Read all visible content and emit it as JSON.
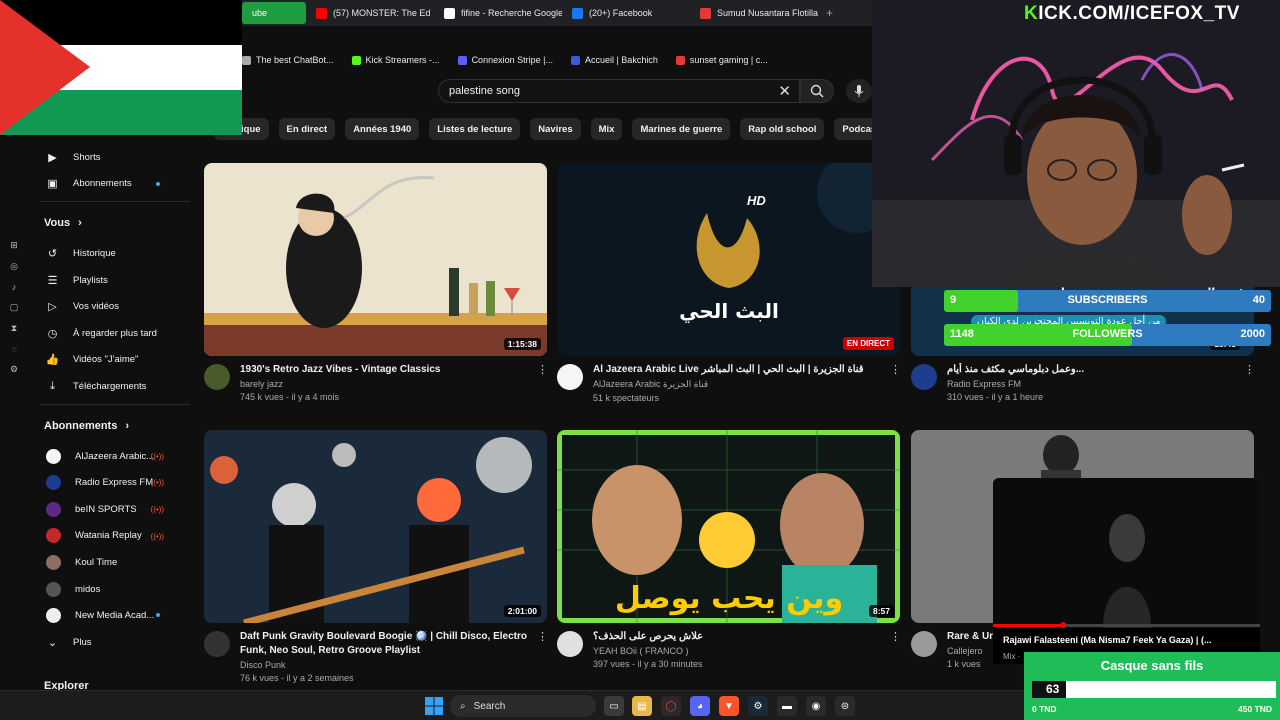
{
  "browser": {
    "tabs": [
      {
        "label": "ube",
        "active": true,
        "icon_color": "#1e9e3e"
      },
      {
        "label": "(57) MONSTER: The Ed",
        "icon_color": "#ff0000"
      },
      {
        "label": "fifine - Recherche Google",
        "icon_color": "#ffffff"
      },
      {
        "label": "(20+) Facebook",
        "icon_color": "#1877f2"
      },
      {
        "label": "Sumud Nusantara Flotilla",
        "icon_color": "#e53935"
      }
    ],
    "bookmarks": [
      {
        "label": "The best ChatBot...",
        "icon_color": "#aaaaaa"
      },
      {
        "label": "Kick Streamers -...",
        "icon_color": "#53fc18"
      },
      {
        "label": "Connexion Stripe |...",
        "icon_color": "#635bff"
      },
      {
        "label": "Accueil | Bakchich",
        "icon_color": "#3b5bdb"
      },
      {
        "label": "sunset gaming | c...",
        "icon_color": "#e53935"
      }
    ]
  },
  "youtube": {
    "search": {
      "value": "palestine song"
    },
    "chips": [
      "Musique",
      "En direct",
      "Années 1940",
      "Listes de lecture",
      "Navires",
      "Mix",
      "Marines de guerre",
      "Rap old school",
      "Podcasts"
    ],
    "sidebar": {
      "top_items": [
        {
          "label": "Shorts",
          "icon": "shorts-icon",
          "glyph": "▶"
        },
        {
          "label": "Abonnements",
          "icon": "subscriptions-icon",
          "glyph": "▣",
          "dot": true
        }
      ],
      "you_heading": "Vous",
      "you_items": [
        {
          "label": "Historique",
          "icon": "history-icon",
          "glyph": "↺"
        },
        {
          "label": "Playlists",
          "icon": "playlists-icon",
          "glyph": "☰"
        },
        {
          "label": "Vos vidéos",
          "icon": "your-videos-icon",
          "glyph": "▷"
        },
        {
          "label": "À regarder plus tard",
          "icon": "watch-later-icon",
          "glyph": "◷"
        },
        {
          "label": "Vidéos \"J'aime\"",
          "icon": "liked-icon",
          "glyph": "👍"
        },
        {
          "label": "Téléchargements",
          "icon": "downloads-icon",
          "glyph": "⤓"
        }
      ],
      "subs_heading": "Abonnements",
      "subs": [
        {
          "label": "AlJazeera Arabic...",
          "color": "#f5f5f5",
          "live": true
        },
        {
          "label": "Radio Express FM",
          "color": "#1d3d8f",
          "live": true
        },
        {
          "label": "beIN SPORTS",
          "color": "#5b2a86",
          "live": true
        },
        {
          "label": "Watania Replay",
          "color": "#c62828",
          "live": true
        },
        {
          "label": "Koul Time",
          "color": "#8d6e63",
          "live": false
        },
        {
          "label": "midos",
          "color": "#555555",
          "live": false
        },
        {
          "label": "New Media Acad...",
          "color": "#eeeeee",
          "dot": true
        }
      ],
      "more_label": "Plus",
      "explorer_label": "Explorer"
    },
    "videos": [
      {
        "title": "1930's Retro Jazz Vibes - Vintage Classics",
        "channel": "barely jazz",
        "stats": "745 k vues - il y a 4 mois",
        "duration": "1:15:38",
        "avatar_color": "#4a5a2a"
      },
      {
        "title": "Al Jazeera Arabic Live قناة الجزيرة | البث الحي | البث المباشر",
        "channel": "AlJazeera Arabic قناة الجزيرة",
        "stats": "51 k spectateurs",
        "badge": "EN DIRECT",
        "avatar_color": "#f5f5f5"
      },
      {
        "title": "وعمل دبلوماسي مكثف منذ أيام...",
        "channel": "Radio Express FM",
        "stats": "310 vues - il y a 1 heure",
        "avatar_color": "#1d3d8f",
        "thumb_time": "18:45"
      },
      {
        "title": "Daft Punk Gravity Boulevard Boogie 🪩 | Chill Disco, Electro Funk, Neo Soul, Retro Groove Playlist",
        "channel": "Disco Punk",
        "stats": "76 k vues - il y a 2 semaines",
        "duration": "2:01:00",
        "avatar_color": "#333333"
      },
      {
        "title": "علاش يحرص على الحذف؟",
        "channel": "YEAH BOii ( FRANCO )",
        "stats": "397 vues - il y a 30 minutes",
        "duration": "8:57",
        "avatar_color": "#e0e0e0"
      },
      {
        "title": "Rare & Unr",
        "channel": "Callejero",
        "stats": "1 k vues",
        "avatar_color": "#999999"
      }
    ],
    "thumb_texts": {
      "aj_hd": "HD",
      "aj_live": "البث الحي",
      "yeah": "وين يحب يوصل",
      "radio_line1": "رئيس الجمهورية يدعو بضرورة مضا",
      "radio_line2": "من أجل عودة التونسيين المحتجزين لدى الكيان"
    }
  },
  "stream": {
    "kick_url": "ICK.COM/ICEFOX_TV",
    "kick_k": "K",
    "subs": {
      "value": 9,
      "goal": 40,
      "label": "SUBSCRIBERS"
    },
    "followers": {
      "value": 1148,
      "goal": 2000,
      "label": "FOLLOWERS"
    },
    "mini": {
      "title": "Rajawi Falasteeni (Ma Nisma7 Feek Ya Gaza) | (...",
      "sub": "Mix ·"
    },
    "casque": {
      "title": "Casque sans fils",
      "value": "63",
      "min": "0 TND",
      "max": "450 TND",
      "progress": 0.14
    }
  },
  "taskbar": {
    "search_label": "Search"
  }
}
